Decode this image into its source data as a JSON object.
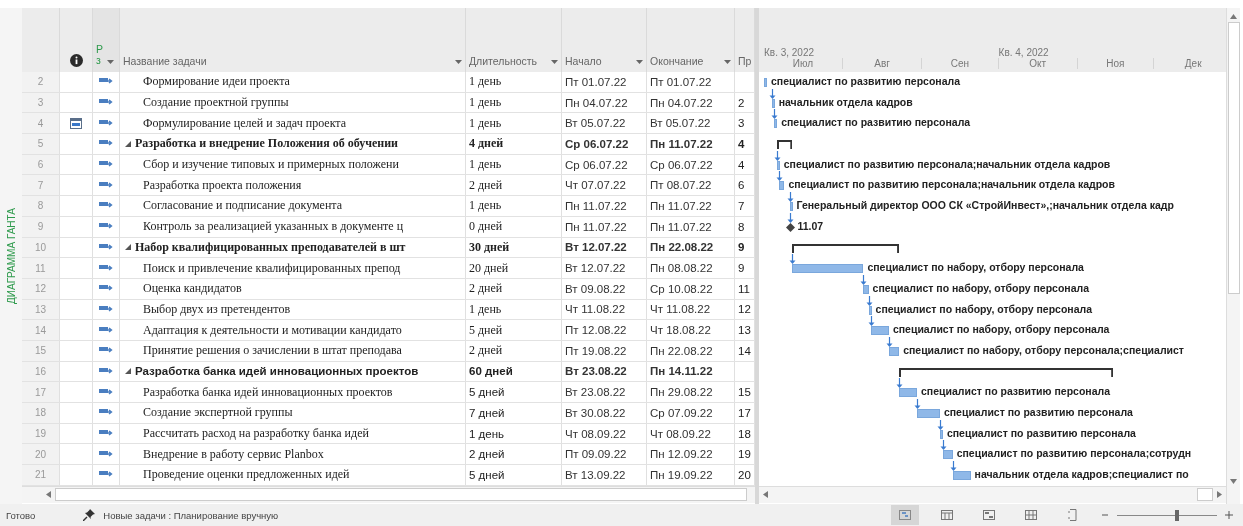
{
  "view_tab": "ДИАГРАММА ГАНТА",
  "header": {
    "mode": [
      "Р",
      "з"
    ],
    "name": "Название задачи",
    "duration": "Длительность",
    "start": "Начало",
    "finish": "Окончание",
    "predecessors": "Пр"
  },
  "timeline": {
    "quarters": [
      "Кв. 3, 2022",
      "Кв. 4, 2022"
    ],
    "months": [
      "Июл",
      "Авг",
      "Сен",
      "Окт",
      "Ноя",
      "Дек"
    ]
  },
  "rows": [
    {
      "id": "2",
      "kind": "task",
      "calendar_indicator": false,
      "name": "Формирование идеи проекта",
      "duration": "1 день",
      "start": "Пт 01.07.22",
      "finish": "Пт 01.07.22",
      "bar_label": "специалист по развитию персонала"
    },
    {
      "id": "3",
      "kind": "task",
      "calendar_indicator": false,
      "name": "Создание проектной группы",
      "duration": "1 день",
      "start": "Пн 04.07.22",
      "finish": "Пн 04.07.22",
      "predecessors": "2",
      "bar_label": "начальник отдела кадров"
    },
    {
      "id": "4",
      "kind": "task",
      "calendar_indicator": true,
      "name": "Формулирование целей и задач проекта",
      "duration": "1 день",
      "start": "Вт 05.07.22",
      "finish": "Вт 05.07.22",
      "predecessors": "3",
      "bar_label": "специалист по развитию персонала"
    },
    {
      "id": "5",
      "kind": "summary",
      "expanded": true,
      "calendar_indicator": false,
      "name": "Разработка и внедрение Положения об обучении",
      "duration": "4 дней",
      "start": "Ср 06.07.22",
      "finish": "Пн 11.07.22",
      "predecessors": "4"
    },
    {
      "id": "6",
      "kind": "task",
      "calendar_indicator": false,
      "name": "Сбор и изучение типовых и примерных положени",
      "duration": "1 день",
      "start": "Ср 06.07.22",
      "finish": "Ср 06.07.22",
      "predecessors": "4",
      "bar_label": "специалист по развитию персонала;начальник отдела кадров"
    },
    {
      "id": "7",
      "kind": "task",
      "calendar_indicator": false,
      "name": "Разработка проекта положения",
      "duration": "2 дней",
      "start": "Чт 07.07.22",
      "finish": "Пт 08.07.22",
      "predecessors": "6",
      "bar_label": "специалист по развитию персонала;начальник отдела кадров"
    },
    {
      "id": "8",
      "kind": "task",
      "calendar_indicator": false,
      "name": "Согласование и подписание документа",
      "duration": "1 день",
      "start": "Пн 11.07.22",
      "finish": "Пн 11.07.22",
      "predecessors": "7",
      "bar_label": "Генеральный директор ООО СК «СтройИнвест»,;начальник отдела кадр"
    },
    {
      "id": "9",
      "kind": "milestone",
      "calendar_indicator": false,
      "name": "Контроль за реализацией указанных в документе ц",
      "duration": "0 дней",
      "start": "Пн 11.07.22",
      "finish": "Пн 11.07.22",
      "predecessors": "8",
      "bar_label": "11.07"
    },
    {
      "id": "10",
      "kind": "summary",
      "expanded": true,
      "calendar_indicator": false,
      "name": "Набор квалифицированных преподавателей в шт",
      "duration": "30 дней",
      "start": "Вт 12.07.22",
      "finish": "Пн 22.08.22",
      "predecessors": "9"
    },
    {
      "id": "11",
      "kind": "task",
      "calendar_indicator": false,
      "name": "Поиск и привлечение квалифицированных препод",
      "duration": "20 дней",
      "start": "Вт 12.07.22",
      "finish": "Пн 08.08.22",
      "predecessors": "9",
      "bar_label": "специалист по набору, отбору персонала"
    },
    {
      "id": "12",
      "kind": "task",
      "calendar_indicator": false,
      "name": "Оценка кандидатов",
      "duration": "2 дней",
      "start": "Вт 09.08.22",
      "finish": "Ср 10.08.22",
      "predecessors": "11",
      "bar_label": "специалист по набору, отбору персонала"
    },
    {
      "id": "13",
      "kind": "task",
      "calendar_indicator": false,
      "name": "Выбор двух из претендентов",
      "duration": "1 день",
      "start": "Чт 11.08.22",
      "finish": "Чт 11.08.22",
      "predecessors": "12",
      "bar_label": "специалист по набору, отбору персонала"
    },
    {
      "id": "14",
      "kind": "task",
      "calendar_indicator": false,
      "name": "Адаптация к деятельности и мотивации кандидато",
      "duration": "5 дней",
      "start": "Пт 12.08.22",
      "finish": "Чт 18.08.22",
      "predecessors": "13",
      "bar_label": "специалист по набору, отбору персонала"
    },
    {
      "id": "15",
      "kind": "task",
      "calendar_indicator": false,
      "name": "Принятие решения о зачислении в штат преподава",
      "duration": "2 дней",
      "start": "Пт 19.08.22",
      "finish": "Пн 22.08.22",
      "predecessors": "14",
      "bar_label": "специалист по набору, отбору персонала;специалист"
    },
    {
      "id": "16",
      "kind": "summary",
      "expanded": true,
      "calendar_indicator": false,
      "name": "Разработка банка идей инновационных проектов",
      "duration": "60 дней",
      "start": "Вт 23.08.22",
      "finish": "Пн 14.11.22"
    },
    {
      "id": "17",
      "kind": "task",
      "calendar_indicator": false,
      "name": "Разработка банка идей инновационных проектов",
      "duration": "5 дней",
      "start": "Вт 23.08.22",
      "finish": "Пн 29.08.22",
      "predecessors": "15",
      "bar_label": "специалист по развитию персонала"
    },
    {
      "id": "18",
      "kind": "task",
      "calendar_indicator": false,
      "name": "Создание экспертной группы",
      "duration": "7 дней",
      "start": "Вт 30.08.22",
      "finish": "Ср 07.09.22",
      "predecessors": "17",
      "bar_label": "специалист по развитию персонала"
    },
    {
      "id": "19",
      "kind": "task",
      "calendar_indicator": false,
      "name": "Рассчитать расход на разработку банка идей",
      "duration": "1 день",
      "start": "Чт 08.09.22",
      "finish": "Чт 08.09.22",
      "predecessors": "18",
      "bar_label": "специалист по развитию персонала"
    },
    {
      "id": "20",
      "kind": "task",
      "calendar_indicator": false,
      "name": "Внедрение в работу сервис Planbox",
      "duration": "2 дней",
      "start": "Пт 09.09.22",
      "finish": "Пн 12.09.22",
      "predecessors": "19",
      "bar_label": "специалист по развитию персонала;сотрудн"
    },
    {
      "id": "21",
      "kind": "task",
      "calendar_indicator": false,
      "name": "Проведение оценки предложенных идей",
      "duration": "5 дней",
      "start": "Вт 13.09.22",
      "finish": "Пн 19.09.22",
      "predecessors": "20",
      "bar_label": "начальник отдела кадров;специалист по"
    }
  ],
  "status_bar": {
    "state": "Готово",
    "new_tasks": "Новые задачи : Планирование вручную",
    "zoom": {
      "level": 0.6
    }
  }
}
